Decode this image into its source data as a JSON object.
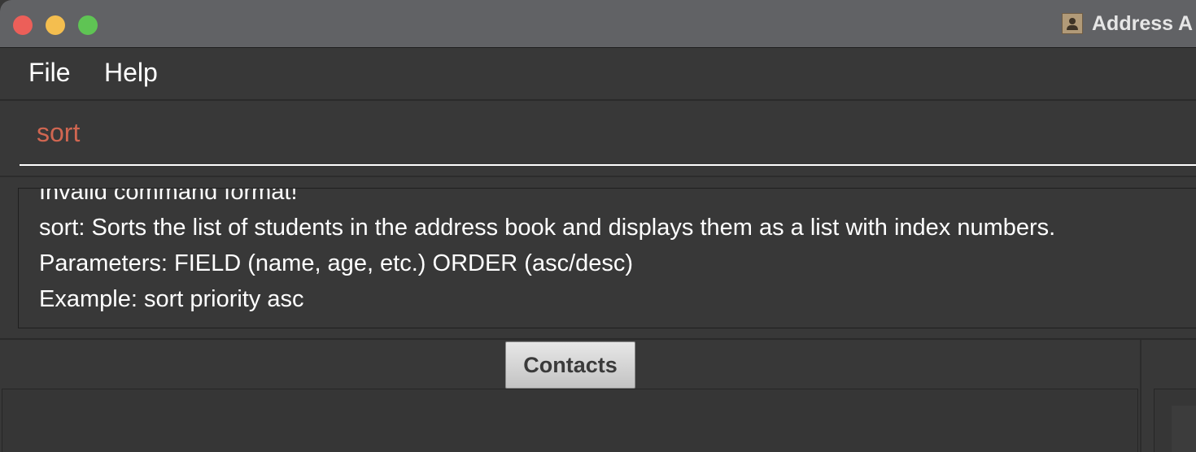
{
  "window": {
    "title": "Address A"
  },
  "menu": {
    "items": [
      {
        "label": "File"
      },
      {
        "label": "Help"
      }
    ]
  },
  "command_box": {
    "value": "sort"
  },
  "result_display": {
    "lines": [
      "Invalid command format!",
      "sort: Sorts the list of students in the address book and displays them as a list with index numbers.",
      "Parameters: FIELD (name, age, etc.) ORDER (asc/desc)",
      "Example: sort priority asc"
    ]
  },
  "tabs": {
    "contacts_label": "Contacts"
  },
  "colors": {
    "titlebar": "#616265",
    "background": "#383838",
    "command_text": "#d06651",
    "close_light": "#ec5f59",
    "minimize_light": "#f4be4f",
    "zoom_light": "#5fc454"
  },
  "icons": {
    "app_icon": "address-book-icon"
  }
}
